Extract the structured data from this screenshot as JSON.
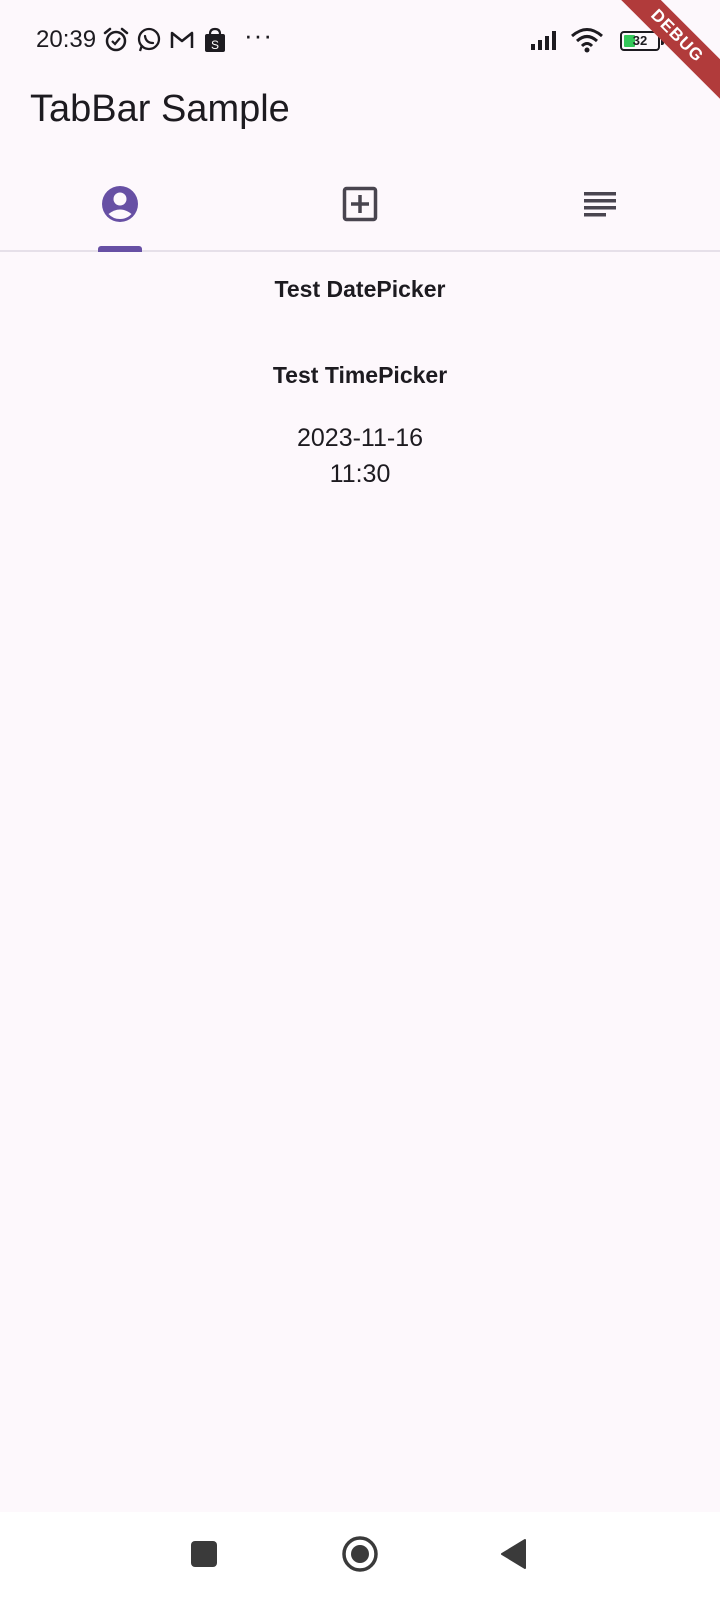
{
  "status_bar": {
    "time": "20:39",
    "battery_level": "32",
    "icons": [
      "alarm-icon",
      "whatsapp-icon",
      "gmail-icon",
      "shop-icon",
      "more-icon",
      "signal-icon",
      "wifi-icon",
      "battery-icon",
      "charging-icon"
    ]
  },
  "debug_banner": "DEBUG",
  "app_bar": {
    "title": "TabBar Sample"
  },
  "tabs": [
    {
      "icon": "account-circle-icon",
      "selected": true
    },
    {
      "icon": "add-box-icon",
      "selected": false
    },
    {
      "icon": "notes-icon",
      "selected": false
    }
  ],
  "colors": {
    "accent": "#6750a4",
    "background": "#fdf8fc",
    "text": "#1d1b20",
    "debug": "#b13b3b"
  },
  "content": {
    "date_picker_label": "Test DatePicker",
    "time_picker_label": "Test TimePicker",
    "selected_date": "2023-11-16",
    "selected_time": "11:30"
  },
  "nav_bar": {
    "buttons": [
      "recents-icon",
      "home-icon",
      "back-icon"
    ]
  }
}
